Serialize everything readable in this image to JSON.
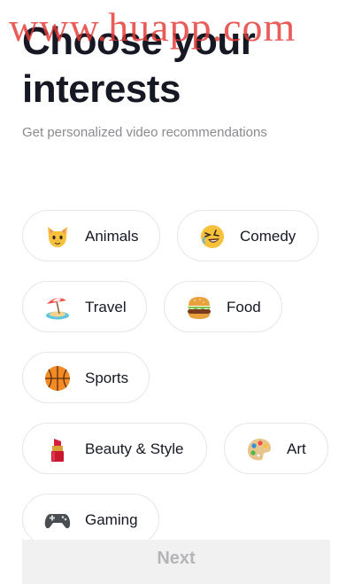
{
  "watermark": "www.huapp.com",
  "page": {
    "title": "Choose your interests",
    "subtitle": "Get personalized video recommendations"
  },
  "interests": [
    {
      "label": "Animals",
      "icon": "cat-face-icon"
    },
    {
      "label": "Comedy",
      "icon": "laughing-face-icon"
    },
    {
      "label": "Travel",
      "icon": "beach-umbrella-icon"
    },
    {
      "label": "Food",
      "icon": "hamburger-icon"
    },
    {
      "label": "Sports",
      "icon": "basketball-icon"
    },
    {
      "label": "Beauty & Style",
      "icon": "lipstick-icon"
    },
    {
      "label": "Art",
      "icon": "artist-palette-icon"
    },
    {
      "label": "Gaming",
      "icon": "video-game-controller-icon"
    }
  ],
  "footer": {
    "next_label": "Next"
  },
  "colors": {
    "text_primary": "#161823",
    "text_secondary": "#8a8b91",
    "chip_border": "#e6e6e8",
    "button_disabled_bg": "#f1f1f2",
    "button_disabled_text": "#b5b5b8",
    "watermark": "#e53935"
  }
}
